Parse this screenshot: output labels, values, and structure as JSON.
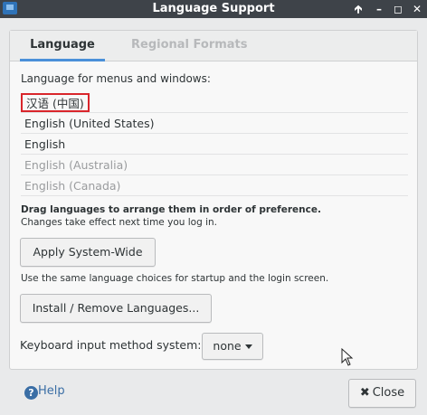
{
  "window": {
    "title": "Language Support",
    "controls": {
      "menu": "🡱",
      "minimize": "–",
      "maximize": "◻",
      "close": "✕"
    }
  },
  "tabs": [
    {
      "label": "Language",
      "active": true
    },
    {
      "label": "Regional Formats",
      "active": false
    }
  ],
  "language": {
    "heading": "Language for menus and windows:",
    "items": [
      {
        "label": "汉语 (中国)",
        "highlighted": true,
        "dim": false
      },
      {
        "label": "English (United States)",
        "dim": false
      },
      {
        "label": "English",
        "dim": false
      },
      {
        "label": "English (Australia)",
        "dim": true
      },
      {
        "label": "English (Canada)",
        "dim": true
      }
    ],
    "drag_note": "Drag languages to arrange them in order of preference.",
    "changes_note": "Changes take effect next time you log in.",
    "apply_button": "Apply System-Wide",
    "same_choices_note": "Use the same language choices for startup and the login screen.",
    "install_button": "Install / Remove Languages...",
    "keyboard_label": "Keyboard input method system:",
    "keyboard_value": "none"
  },
  "footer": {
    "help_icon": "question-circle-icon",
    "help_glyph": "?",
    "help_label": "Help",
    "close_glyph": "✖",
    "close_label": "Close"
  },
  "colors": {
    "titlebar": "#3e4349",
    "tab_accent": "#4a90d9",
    "highlight_border": "#d9252b",
    "help_blue": "#3a6ea5"
  }
}
